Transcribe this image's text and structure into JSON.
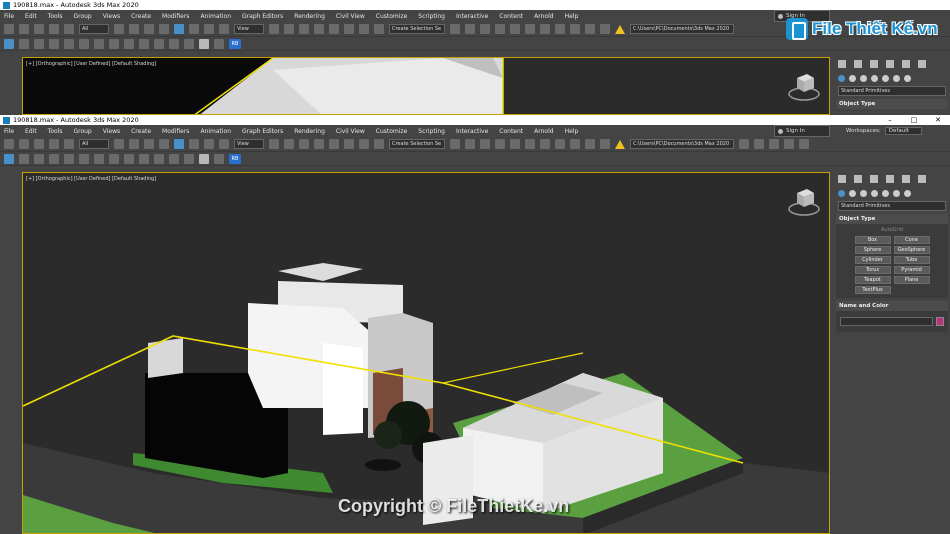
{
  "app": {
    "title_top": "190818.max - Autodesk 3ds Max 2020",
    "title_bottom": "190818.max - Autodesk 3ds Max 2020"
  },
  "menu": [
    "File",
    "Edit",
    "Tools",
    "Group",
    "Views",
    "Create",
    "Modifiers",
    "Animation",
    "Graph Editors",
    "Rendering",
    "Civil View",
    "Customize",
    "Scripting",
    "Interactive",
    "Content",
    "Arnold",
    "Help"
  ],
  "signin": "Sign In",
  "workspaces": {
    "label": "Workspaces:",
    "value": "Default"
  },
  "toolbar": {
    "filter_value": "All",
    "refcoord_value": "View",
    "selection_set_placeholder": "Create Selection Se",
    "project_path": "C:\\Users\\PC\\Documents\\3ds Max 2020",
    "rb_label": "RB"
  },
  "viewport": {
    "label_top": "[+] [Orthographic] [User Defined] [Default Shading]",
    "label_bottom": "[+] [Orthographic] [User Defined] [Default Shading]"
  },
  "command_panel": {
    "category": "Standard Primitives",
    "object_type_title": "Object Type",
    "autogrid": "AutoGrid",
    "primitives": [
      "Box",
      "Cone",
      "Sphere",
      "GeoSphere",
      "Cylinder",
      "Tube",
      "Torus",
      "Pyramid",
      "Teapot",
      "Plane",
      "TextPlus"
    ],
    "name_color_title": "Name and Color",
    "color_swatch": "#c0307a"
  },
  "watermark": "Copyright © FileThietKe.vn",
  "logo_text": "File Thiết Kế.vn",
  "colors": {
    "accent": "#1c93d1",
    "selection_outline": "#f0e000",
    "grass": "#5aa040"
  }
}
